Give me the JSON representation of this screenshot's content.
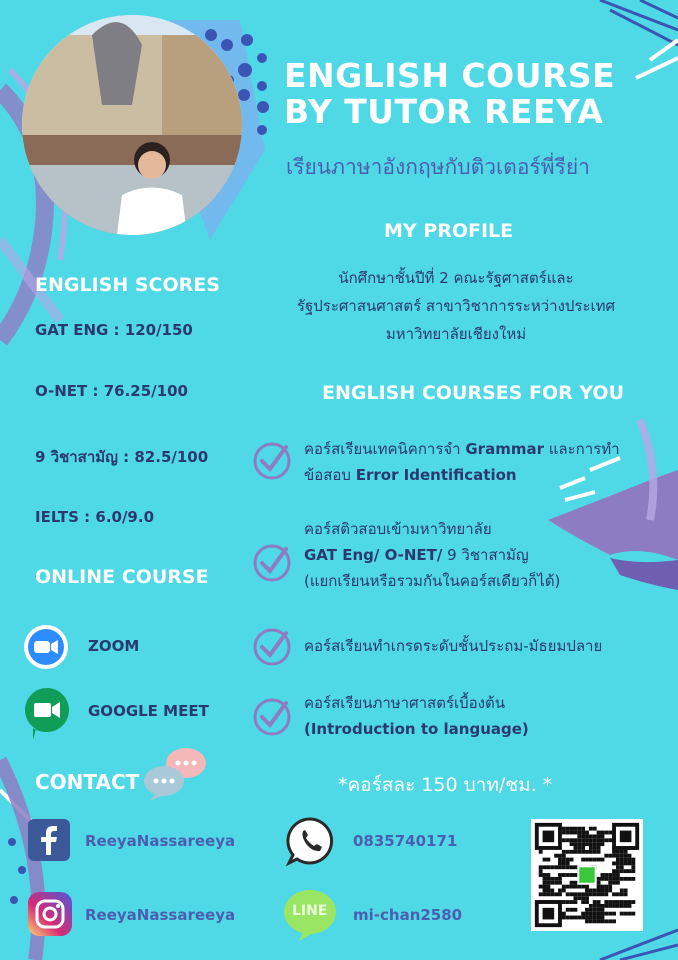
{
  "title": "ENGLISH COURSE BY TUTOR REEYA",
  "subtitle": "เรียนภาษาอังกฤษกับติวเตอร์พี่รีย่า",
  "profile": {
    "heading": "MY PROFILE",
    "line1": "นักศึกษาชั้นปีที่ 2 คณะรัฐศาสตร์และ",
    "line2": "รัฐประศาสนศาสตร์ สาขาวิชาการระหว่างประเทศ",
    "line3": "มหาวิทยาลัยเชียงใหม่"
  },
  "scores": {
    "heading": "ENGLISH SCORES",
    "items": [
      "GAT ENG : 120/150",
      "O-NET : 76.25/100",
      "9 วิชาสามัญ : 82.5/100",
      "IELTS : 6.0/9.0"
    ]
  },
  "courses": {
    "heading": "ENGLISH COURSES FOR YOU",
    "c1_pre": "คอร์สเรียนเทคนิคการจำ ",
    "c1_bold": "Grammar",
    "c1_post": " และการทำ",
    "c1_l2_pre": "ข้อสอบ ",
    "c1_l2_bold": "Error Identification",
    "c2_l1": "คอร์สติวสอบเข้ามหาวิทยาลัย",
    "c2_l2_bold": "GAT Eng/ O-NET/",
    "c2_l2_post": " 9 วิชาสามัญ",
    "c2_l3": "(แยกเรียนหรือรวมกันในคอร์สเดียวก็ได้)",
    "c3": "คอร์สเรียนทำเกรดระดับชั้นประถม-มัธยมปลาย",
    "c4_l1": "คอร์สเรียนภาษาศาสตร์เบื้องต้น",
    "c4_l2": "(Introduction to language)"
  },
  "online": {
    "heading": "ONLINE COURSE",
    "zoom": "ZOOM",
    "meet": "GOOGLE MEET"
  },
  "contact": {
    "heading": "CONTACT",
    "price": "*คอร์สละ 150 บาท/ชม. *",
    "facebook": "ReeyaNassareeya",
    "instagram": "ReeyaNassareeya",
    "phone": "0835740171",
    "line": "mi-chan2580",
    "line_logo": "LINE"
  },
  "colors": {
    "background": "#4fd9e6",
    "title": "#ffffff",
    "text": "#2a3a6e",
    "accent_purple": "#8e7cc3",
    "subtitle": "#4b5fb0"
  }
}
